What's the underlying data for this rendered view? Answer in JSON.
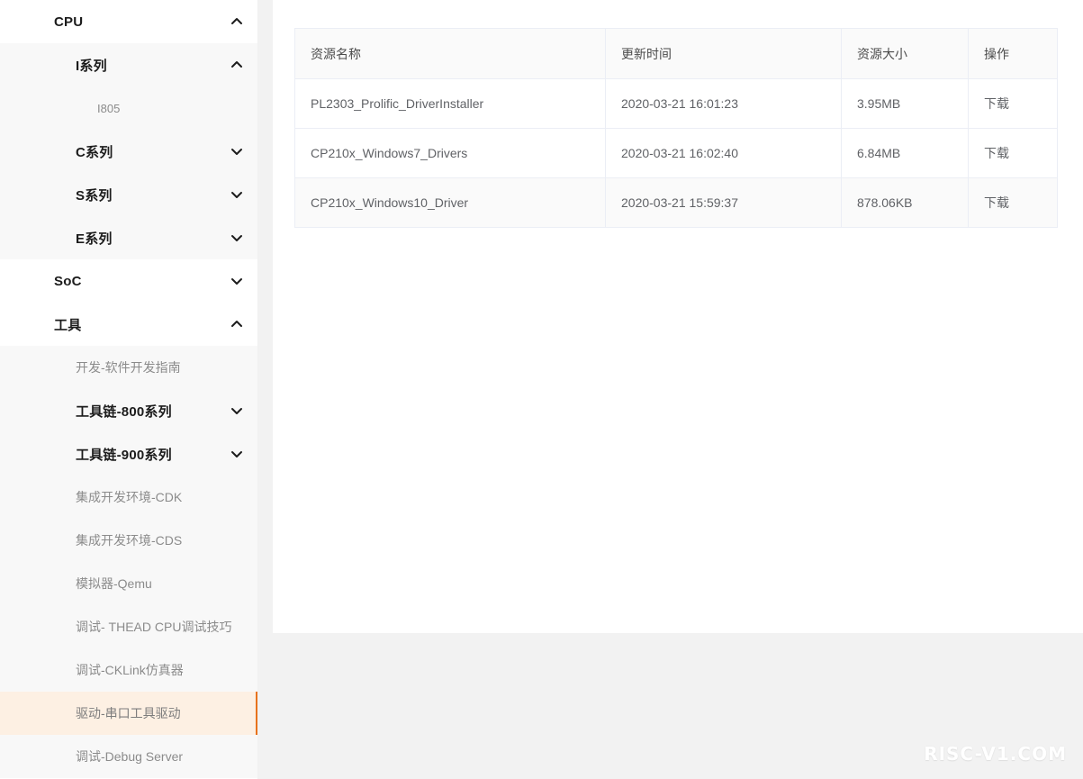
{
  "sidebar": {
    "nodes": [
      {
        "id": "cpu",
        "level": 1,
        "label": "CPU",
        "chevron": "chevron-up-icon",
        "expanded": true
      },
      {
        "id": "i-series",
        "level": 2,
        "label": "I系列",
        "chevron": "chevron-up-icon",
        "expanded": true
      },
      {
        "id": "i805",
        "level": 3,
        "label": "I805",
        "small": true,
        "chevron": "",
        "expanded": false
      },
      {
        "id": "c-series",
        "level": 2,
        "label": "C系列",
        "chevron": "chevron-down-icon",
        "expanded": false
      },
      {
        "id": "s-series",
        "level": 2,
        "label": "S系列",
        "chevron": "chevron-down-icon",
        "expanded": false
      },
      {
        "id": "e-series",
        "level": 2,
        "label": "E系列",
        "chevron": "chevron-down-icon",
        "expanded": false
      },
      {
        "id": "soc",
        "level": 1,
        "label": "SoC",
        "chevron": "chevron-down-icon",
        "expanded": false
      },
      {
        "id": "tools",
        "level": 1,
        "label": "工具",
        "chevron": "chevron-up-icon",
        "expanded": true
      },
      {
        "id": "dev-guide",
        "level": 3,
        "label": "开发-软件开发指南",
        "chevron": "",
        "expanded": false
      },
      {
        "id": "toolchain-800",
        "level": 2,
        "label": "工具链-800系列",
        "chevron": "chevron-down-icon",
        "expanded": false
      },
      {
        "id": "toolchain-900",
        "level": 2,
        "label": "工具链-900系列",
        "chevron": "chevron-down-icon",
        "expanded": false
      },
      {
        "id": "ide-cdk",
        "level": 3,
        "label": "集成开发环境-CDK",
        "chevron": "",
        "expanded": false
      },
      {
        "id": "ide-cds",
        "level": 3,
        "label": "集成开发环境-CDS",
        "chevron": "",
        "expanded": false
      },
      {
        "id": "qemu",
        "level": 3,
        "label": "模拟器-Qemu",
        "chevron": "",
        "expanded": false
      },
      {
        "id": "thead-cpu-debug",
        "level": 3,
        "label": "调试- THEAD CPU调试技巧",
        "chevron": "",
        "expanded": false
      },
      {
        "id": "cklink",
        "level": 3,
        "label": "调试-CKLink仿真器",
        "chevron": "",
        "expanded": false
      },
      {
        "id": "serial-driver",
        "level": 3,
        "label": "驱动-串口工具驱动",
        "chevron": "",
        "expanded": false,
        "active": true
      },
      {
        "id": "debug-server",
        "level": 3,
        "label": "调试-Debug Server",
        "chevron": "",
        "expanded": false
      }
    ],
    "active_accent_color": "#e8721c",
    "active_background_color": "#fdf0e3"
  },
  "resource_table": {
    "columns": [
      {
        "key": "name",
        "label": "资源名称"
      },
      {
        "key": "updated",
        "label": "更新时间"
      },
      {
        "key": "size",
        "label": "资源大小"
      },
      {
        "key": "action",
        "label": "操作"
      }
    ],
    "rows": [
      {
        "name": "PL2303_Prolific_DriverInstaller",
        "updated": "2020-03-21 16:01:23",
        "size": "3.95MB",
        "action": "下载"
      },
      {
        "name": "CP210x_Windows7_Drivers",
        "updated": "2020-03-21 16:02:40",
        "size": "6.84MB",
        "action": "下载"
      },
      {
        "name": "CP210x_Windows10_Driver",
        "updated": "2020-03-21 15:59:37",
        "size": "878.06KB",
        "action": "下载"
      }
    ]
  },
  "watermark": {
    "text": "RISC-V1.COM"
  }
}
